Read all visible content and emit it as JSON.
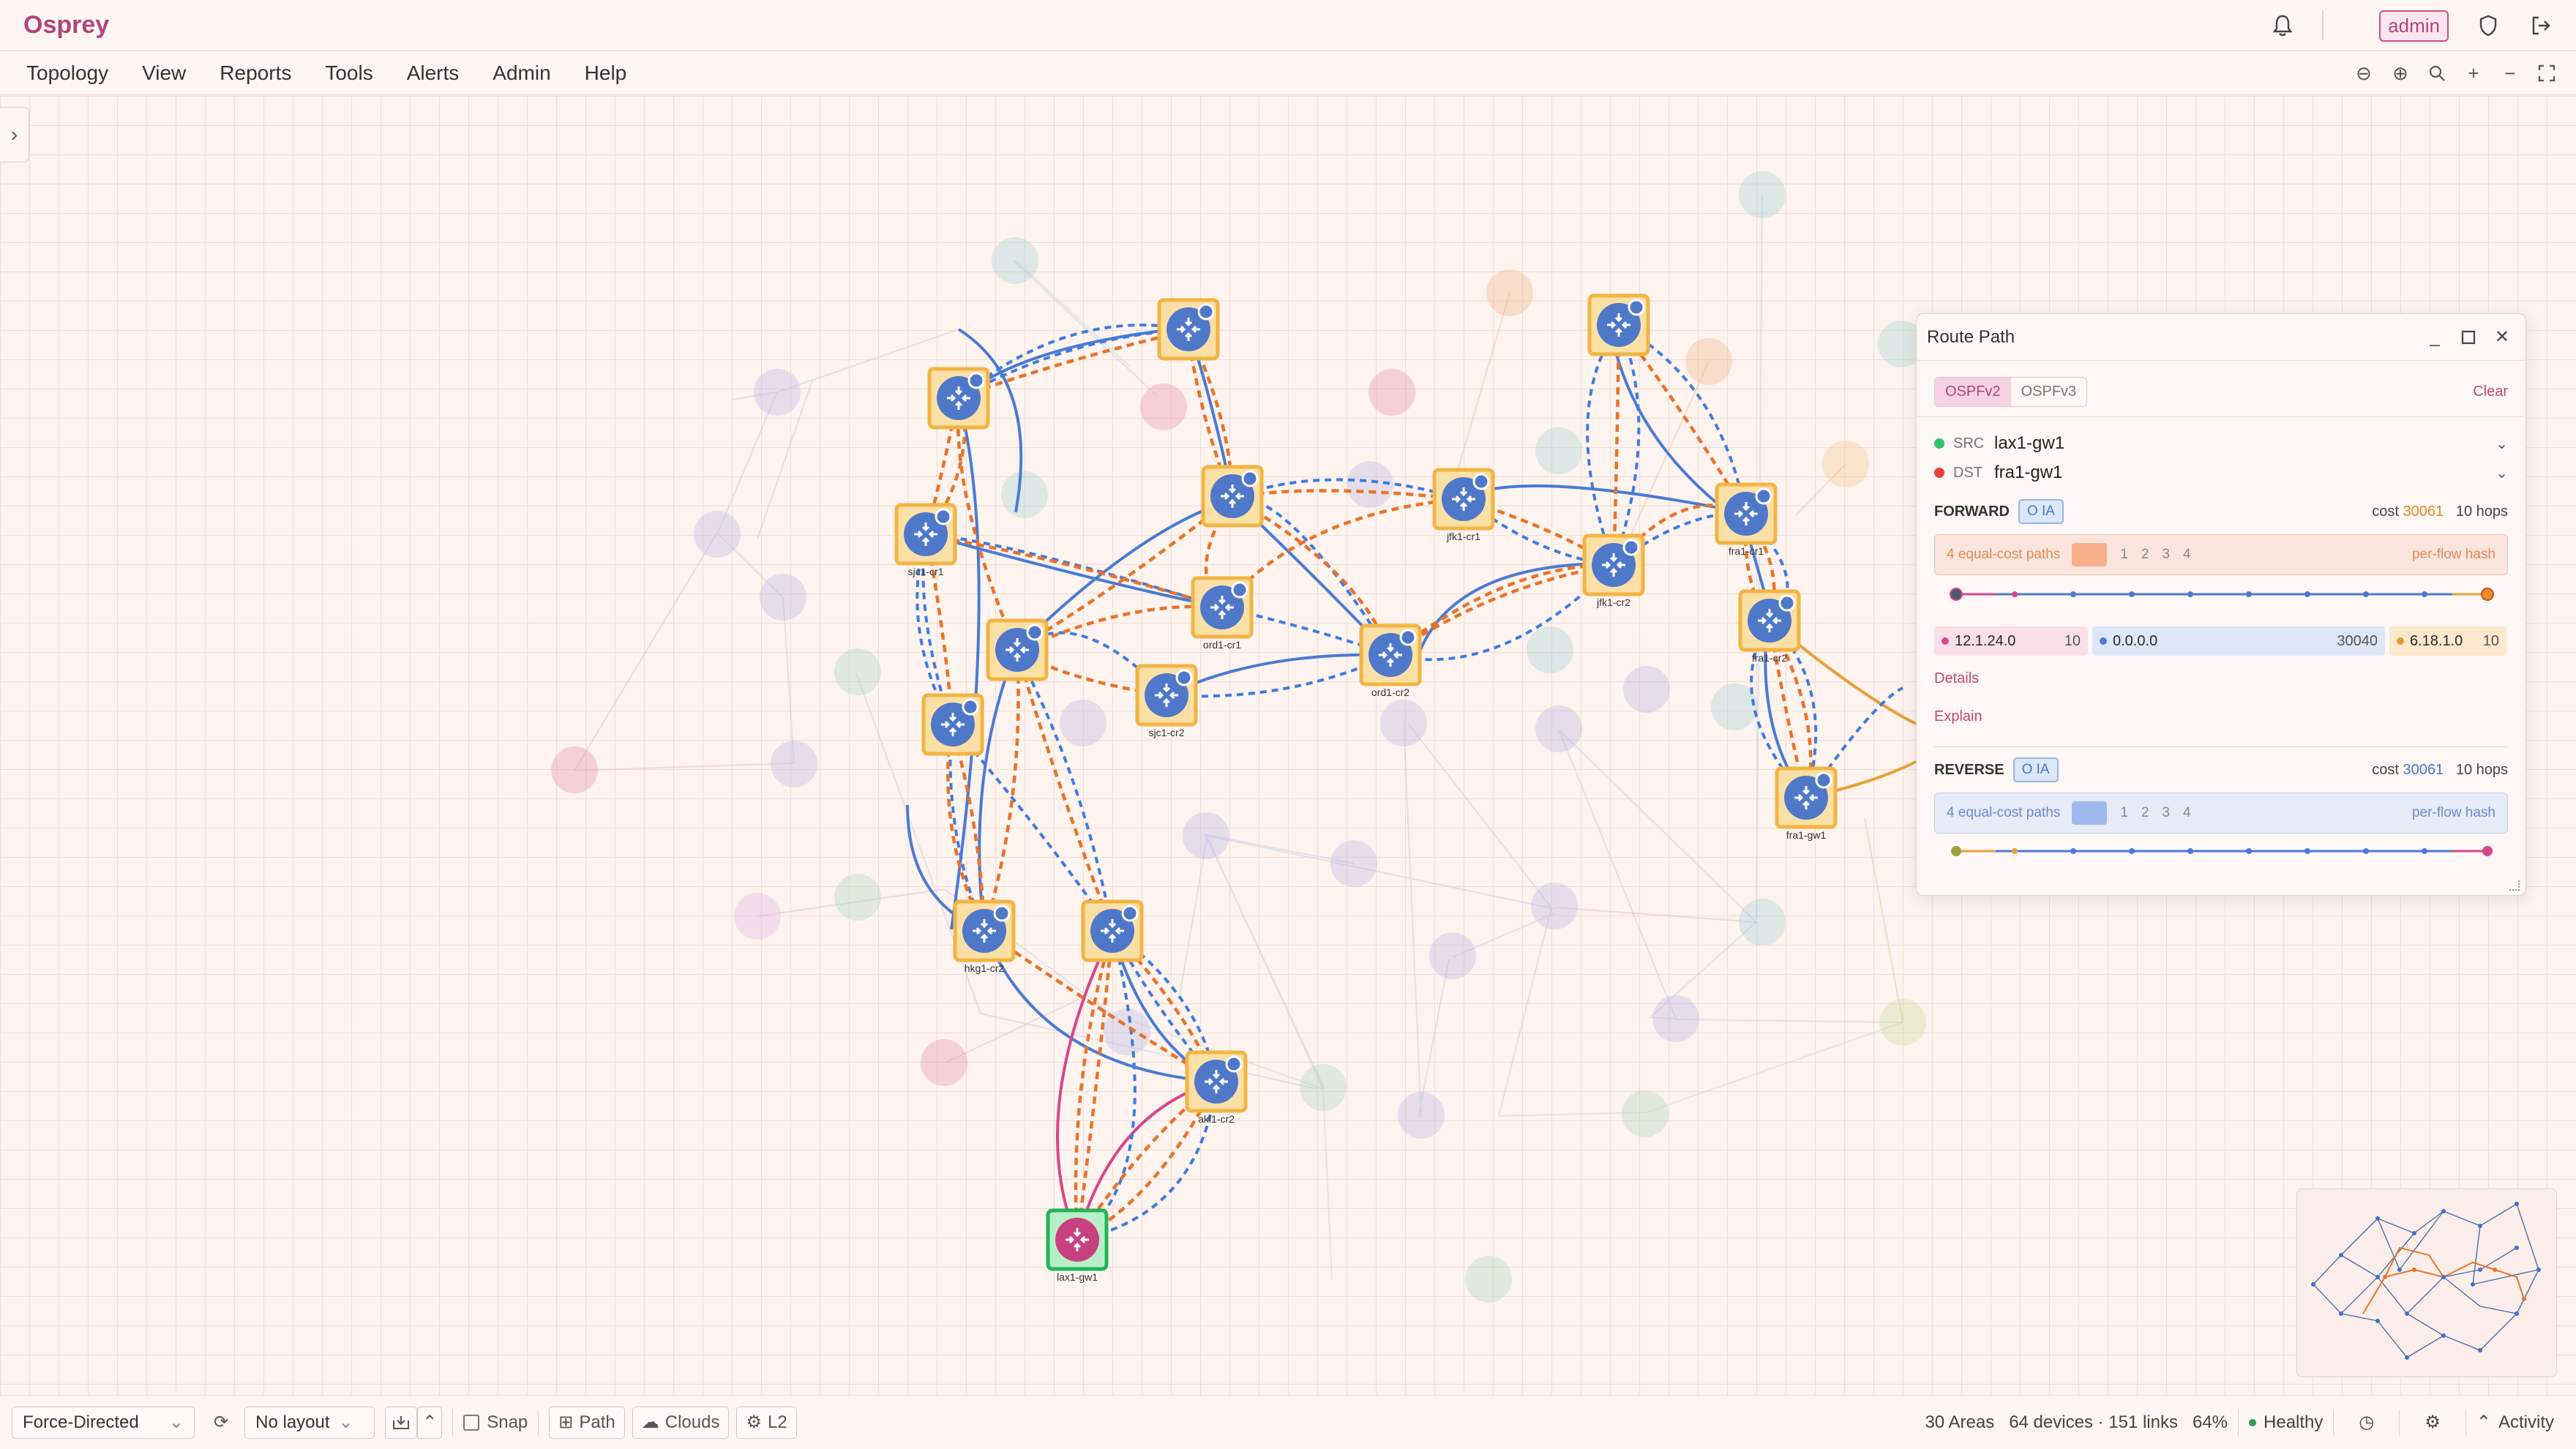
{
  "app": {
    "title": "Osprey"
  },
  "header": {
    "user": "admin"
  },
  "menu": [
    "Topology",
    "View",
    "Reports",
    "Tools",
    "Alerts",
    "Admin",
    "Help"
  ],
  "nodes": [
    {
      "id": "lax1-gw1",
      "label": "lax1-gw1",
      "role": "src"
    },
    {
      "id": "fra1-gw1",
      "label": "fra1-gw1",
      "role": "dst"
    },
    {
      "id": "ord1-cr2",
      "label": "ord1-cr2",
      "role": "hop"
    },
    {
      "id": "sjc1-cr2",
      "label": "sjc1-cr2",
      "role": "hop"
    },
    {
      "id": "ord1-cr1",
      "label": "ord1-cr1",
      "role": "hop"
    },
    {
      "id": "jfk1-cr1",
      "label": "jfk1-cr1",
      "role": "hop"
    },
    {
      "id": "jfk1-cr2",
      "label": "jfk1-cr2",
      "role": "hop"
    },
    {
      "id": "fra1-cr2",
      "label": "fra1-cr2",
      "role": "hop"
    },
    {
      "id": "fra1-cr1",
      "label": "fra1-cr1",
      "role": "hop"
    },
    {
      "id": "hkg1-cr2",
      "label": "hkg1-cr2",
      "role": "hop"
    },
    {
      "id": "sjc1-cr1",
      "label": "sjc1-cr1",
      "role": "hop"
    },
    {
      "id": "akl1-cr2",
      "label": "akl1-cr2",
      "role": "hop"
    }
  ],
  "route_panel": {
    "title": "Route Path",
    "tabs": [
      "OSPFv2",
      "OSPFv3"
    ],
    "clear": "Clear",
    "src_label": "SRC",
    "src": "lax1-gw1",
    "dst_label": "DST",
    "dst": "fra1-gw1",
    "forward": {
      "label": "FORWARD",
      "badge": "O IA",
      "cost_label": "cost",
      "cost": "30061",
      "hops": "10 hops",
      "ecmp": "4 equal-cost paths",
      "options": [
        "1",
        "2",
        "3",
        "4"
      ],
      "hash": "per-flow hash",
      "areas": [
        {
          "area": "12.1.24.0",
          "cost": "10",
          "color": "#d9468a",
          "bg": "#f9dfe8"
        },
        {
          "area": "0.0.0.0",
          "cost": "30040",
          "color": "#4a7bd4",
          "bg": "#dde7f8"
        },
        {
          "area": "6.18.1.0",
          "cost": "10",
          "color": "#e09a22",
          "bg": "#fbe8cd"
        }
      ]
    },
    "details": "Details",
    "explain": "Explain",
    "reverse": {
      "label": "REVERSE",
      "badge": "O IA",
      "cost_label": "cost",
      "cost": "30061",
      "hops": "10 hops",
      "ecmp": "4 equal-cost paths",
      "options": [
        "1",
        "2",
        "3",
        "4"
      ],
      "hash": "per-flow hash"
    }
  },
  "bottom": {
    "layout": "Force-Directed",
    "preset": "No layout",
    "snap": "Snap",
    "path": "Path",
    "clouds": "Clouds",
    "l2": "L2",
    "areas": "30 Areas",
    "devices": "64 devices · 151 links",
    "zoom": "64%",
    "health": "Healthy",
    "activity": "Activity"
  },
  "colors": {
    "accent": "#b0447a",
    "path": "#e8732a",
    "link": "#4a7bd4",
    "healthy": "#2e9d57"
  }
}
